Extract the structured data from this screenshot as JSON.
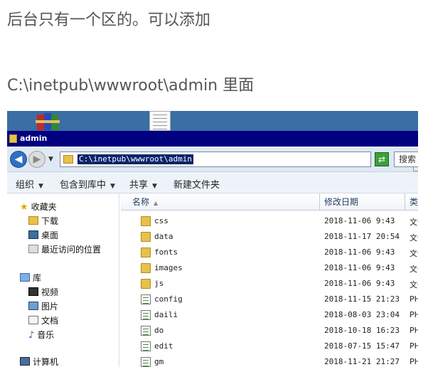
{
  "article": {
    "line1": "后台只有一个区的。可以添加",
    "line2": "C:\\inetpub\\wwwroot\\admin 里面"
  },
  "window": {
    "title": "admin",
    "address": "C:\\inetpub\\wwwroot\\admin",
    "search_label": "搜索"
  },
  "toolbar": {
    "organize": "组织",
    "include_in_library": "包含到库中",
    "share": "共享",
    "new_folder": "新建文件夹"
  },
  "sidebar": {
    "favorites": "收藏夹",
    "downloads": "下载",
    "desktop": "桌面",
    "recent": "最近访问的位置",
    "libraries": "库",
    "videos": "视频",
    "pictures": "图片",
    "documents": "文档",
    "music": "音乐",
    "computer": "计算机"
  },
  "columns": {
    "name": "名称",
    "date": "修改日期",
    "type": "类型"
  },
  "files": [
    {
      "name": "css",
      "date": "2018-11-06 9:43",
      "type": "文件"
    },
    {
      "name": "data",
      "date": "2018-11-17 20:54",
      "type": "文件"
    },
    {
      "name": "fonts",
      "date": "2018-11-06 9:43",
      "type": "文件"
    },
    {
      "name": "images",
      "date": "2018-11-06 9:43",
      "type": "文件"
    },
    {
      "name": "js",
      "date": "2018-11-06 9:43",
      "type": "文件"
    },
    {
      "name": "config",
      "date": "2018-11-15 21:23",
      "type": "PHP"
    },
    {
      "name": "daili",
      "date": "2018-08-03 23:04",
      "type": "PHP"
    },
    {
      "name": "do",
      "date": "2018-10-18 16:23",
      "type": "PHP"
    },
    {
      "name": "edit",
      "date": "2018-07-15 15:47",
      "type": "PHP"
    },
    {
      "name": "gm",
      "date": "2018-11-21 21:27",
      "type": "PHP"
    }
  ]
}
